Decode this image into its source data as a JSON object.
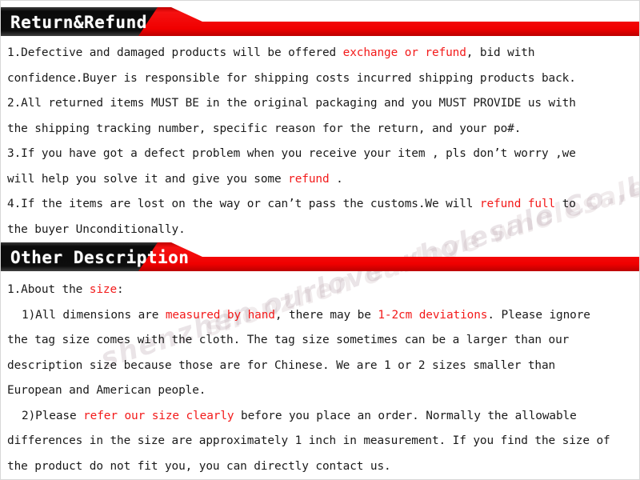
{
  "colors": {
    "banner_black": "#111111",
    "banner_red": "#ee0000",
    "highlight_red": "#f31a1a",
    "body_text": "#1a1a1a",
    "page_background": "#ffffff"
  },
  "watermark": {
    "text": "shenzhen ourlove wholesale Co.,Ltd"
  },
  "sections": [
    {
      "banner_title": "Return&Refund",
      "lines": [
        [
          {
            "t": "1.Defective and damaged products will be offered ",
            "hl": false
          },
          {
            "t": "exchange or refund",
            "hl": true
          },
          {
            "t": ", bid with",
            "hl": false
          }
        ],
        [
          {
            "t": "confidence.Buyer is responsible for shipping costs incurred shipping products back.",
            "hl": false
          }
        ],
        [
          {
            "t": "2.All returned items MUST BE in the original packaging and you MUST PROVIDE us with",
            "hl": false
          }
        ],
        [
          {
            "t": "the shipping tracking number, specific reason for the return, and your po#.",
            "hl": false
          }
        ],
        [
          {
            "t": "3.If you have got a defect problem when you receive your item , pls don’t worry ,we",
            "hl": false
          }
        ],
        [
          {
            "t": "will help you solve it and give you some ",
            "hl": false
          },
          {
            "t": "refund",
            "hl": true
          },
          {
            "t": " .",
            "hl": false
          }
        ],
        [
          {
            "t": "4.If the items are lost on the way or can’t pass the customs.We will ",
            "hl": false
          },
          {
            "t": "refund full",
            "hl": true
          },
          {
            "t": " to",
            "hl": false
          }
        ],
        [
          {
            "t": "the buyer Unconditionally.",
            "hl": false
          }
        ]
      ]
    },
    {
      "banner_title": "Other Description",
      "lines": [
        [
          {
            "t": "1.About the ",
            "hl": false
          },
          {
            "t": "size",
            "hl": true
          },
          {
            "t": ":",
            "hl": false
          }
        ],
        [
          {
            "t": "1)All dimensions are ",
            "hl": false,
            "indent": true
          },
          {
            "t": "measured by hand",
            "hl": true
          },
          {
            "t": ", there may be ",
            "hl": false
          },
          {
            "t": "1-2cm deviations",
            "hl": true
          },
          {
            "t": ". Please ignore",
            "hl": false
          }
        ],
        [
          {
            "t": "the tag size comes with the cloth. The tag size sometimes can be a larger than our",
            "hl": false
          }
        ],
        [
          {
            "t": "description size because those are for Chinese. We are 1 or 2 sizes smaller than",
            "hl": false
          }
        ],
        [
          {
            "t": "European and American people.",
            "hl": false
          }
        ],
        [
          {
            "t": "2)Please ",
            "hl": false,
            "indent": true
          },
          {
            "t": "refer our size clearly",
            "hl": true
          },
          {
            "t": " before you place an order. Normally the allowable",
            "hl": false
          }
        ],
        [
          {
            "t": "differences in the size are approximately 1 inch in measurement. If you find the size of",
            "hl": false
          }
        ],
        [
          {
            "t": "the product do not fit you, you can directly contact us.",
            "hl": false
          }
        ]
      ]
    }
  ]
}
